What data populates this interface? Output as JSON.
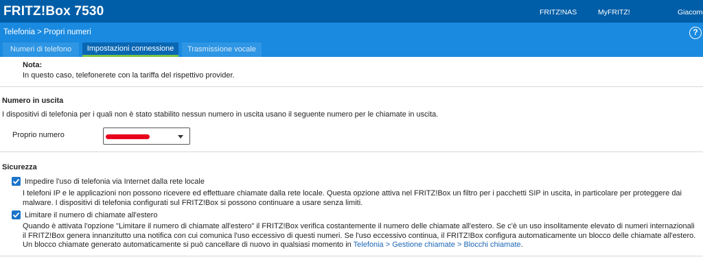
{
  "header": {
    "brand": "FRITZ!Box 7530",
    "links": [
      "FRITZ!NAS",
      "MyFRITZ!",
      "Giacomo"
    ]
  },
  "breadcrumb": {
    "parent": "Telefonia",
    "separator": ">",
    "current": "Propri numeri",
    "help": "?"
  },
  "tabs": [
    {
      "label": "Numeri di telefono",
      "active": false
    },
    {
      "label": "Impostazioni connessione",
      "active": true
    },
    {
      "label": "Trasmissione vocale",
      "active": false
    }
  ],
  "note": {
    "title": "Nota:",
    "text": "In questo caso, telefonerete con la tariffa del rispettivo provider."
  },
  "outgoing": {
    "title": "Numero in uscita",
    "description": "I dispositivi di telefonia per i quali non è stato stabilito nessun numero in uscita usano il seguente numero per le chiamate in uscita.",
    "field_label": "Proprio numero"
  },
  "security": {
    "title": "Sicurezza",
    "option1": {
      "label": "Impedire l'uso di telefonia via Internet dalla rete locale",
      "checked": true,
      "description": "I telefoni IP e le applicazioni non possono ricevere ed effettuare chiamate dalla rete locale. Questa opzione attiva nel FRITZ!Box un filtro per i pacchetti SIP in uscita, in particolare per proteggere dai malware. I dispositivi di telefonia configurati sul FRITZ!Box si possono continuare a usare senza limiti."
    },
    "option2": {
      "label": "Limitare il numero di chiamate all'estero",
      "checked": true,
      "description": "Quando è attivata l'opzione \"Limitare il numero di chiamate all'estero\" il FRITZ!Box verifica costantemente il numero delle chiamate all'estero. Se c'è un uso insolitamente elevato di numeri internazionali il FRITZ!Box genera innanzitutto una notifica con cui comunica l'uso eccessivo di questi numeri. Se l'uso eccessivo continua, il FRITZ!Box configura automaticamente un blocco delle chiamate all'estero. Un blocco chiamate generato automaticamente si può cancellare di nuovo in qualsiasi momento in",
      "link": "Telefonia > Gestione chiamate > Blocchi chiamate",
      "suffix": "."
    }
  },
  "colors": {
    "topbar": "#005ea8",
    "navbar": "#1a8ae0",
    "active_tab_underline": "#79c24a",
    "checkbox": "#1c75c8",
    "link": "#1c66b5",
    "redaction": "#e8001c"
  }
}
